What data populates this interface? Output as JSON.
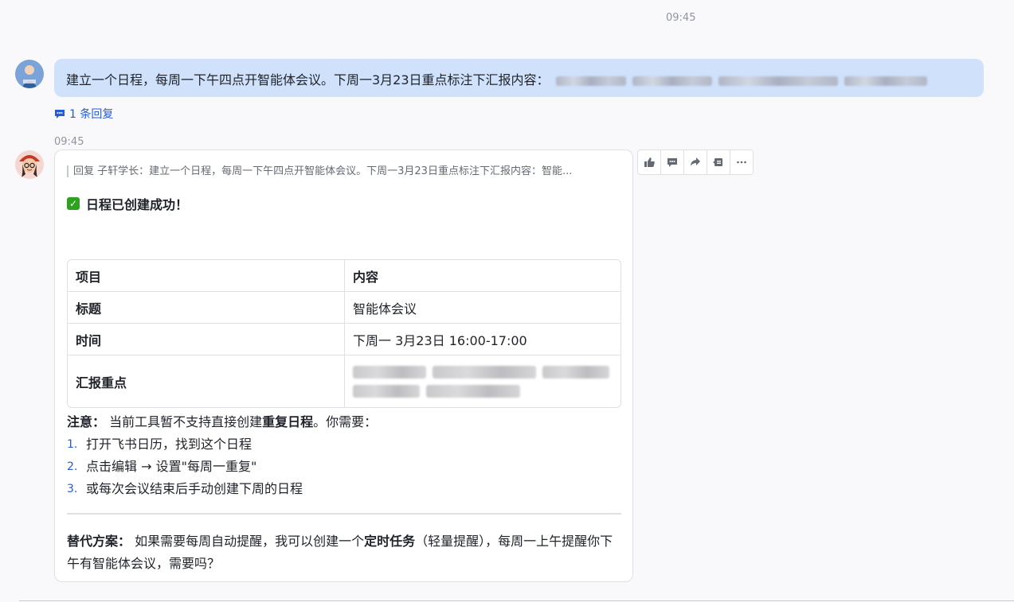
{
  "timestamps": {
    "top": "09:45",
    "bot": "09:45"
  },
  "user_message": {
    "text": "建立一个日程，每周一下午四点开智能体会议。下周一3月23日重点标注下汇报内容："
  },
  "reply_link": {
    "label": "1 条回复"
  },
  "bot_message": {
    "quote": "回复 子轩学长：建立一个日程，每周一下午四点开智能体会议。下周一3月23日重点标注下汇报内容：智能...",
    "success": "日程已创建成功！",
    "table": {
      "headers": [
        "项目",
        "内容"
      ],
      "rows": [
        {
          "key": "标题",
          "value": "智能体会议"
        },
        {
          "key": "时间",
          "value": "下周一 3月23日 16:00-17:00"
        },
        {
          "key": "汇报重点",
          "value": ""
        }
      ]
    },
    "note": {
      "label": "注意：",
      "text_before": " 当前工具暂不支持直接创建",
      "bold": "重复日程",
      "text_after": "。你需要：",
      "steps": [
        {
          "num": "1.",
          "text": "打开飞书日历，找到这个日程"
        },
        {
          "num": "2.",
          "text": "点击编辑 → 设置\"每周一重复\""
        },
        {
          "num": "3.",
          "text": "或每次会议结束后手动创建下周的日程"
        }
      ]
    },
    "alternative": {
      "label": "替代方案：",
      "text_before": " 如果需要每周自动提醒，我可以创建一个",
      "bold": "定时任务",
      "text_after": "（轻量提醒），每周一上午提醒你下午有智能体会议，需要吗？"
    }
  },
  "toolbar": {
    "icons": [
      "thumbs-up-icon",
      "comment-icon",
      "forward-icon",
      "pin-icon",
      "more-icon"
    ]
  },
  "colors": {
    "user_bubble": "#cfe1fb",
    "link": "#245bdb",
    "success_check": "#2ea121"
  }
}
